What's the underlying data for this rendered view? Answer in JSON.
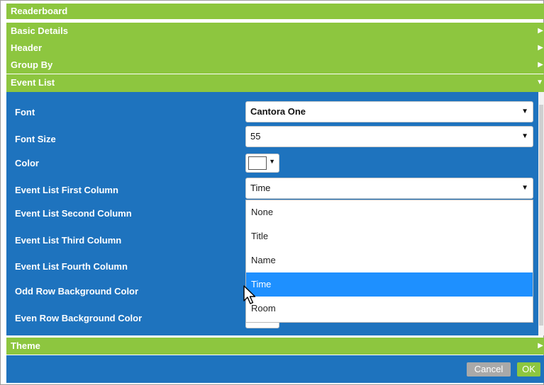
{
  "dialog": {
    "title": "Readerboard"
  },
  "sections": [
    {
      "label": "Basic Details",
      "arrow": "▶"
    },
    {
      "label": "Header",
      "arrow": "▶"
    },
    {
      "label": "Group By",
      "arrow": "▶"
    },
    {
      "label": "Event List",
      "arrow": "▼"
    },
    {
      "label": "Theme",
      "arrow": "▶"
    }
  ],
  "event_list": {
    "fields": {
      "font": {
        "label": "Font",
        "value": "Cantora One"
      },
      "font_size": {
        "label": "Font Size",
        "value": "55"
      },
      "color": {
        "label": "Color",
        "value": "#ffffff"
      },
      "first_column": {
        "label": "Event List First Column",
        "value": "Time"
      },
      "second_column": {
        "label": "Event List Second Column"
      },
      "third_column": {
        "label": "Event List Third Column"
      },
      "fourth_column": {
        "label": "Event List Fourth Column"
      },
      "odd_row_bg": {
        "label": "Odd Row Background Color"
      },
      "even_row_bg": {
        "label": "Even Row Background Color"
      }
    },
    "caret": "▼",
    "open_dropdown": {
      "options": [
        "None",
        "Title",
        "Name",
        "Time",
        "Room"
      ],
      "selected": "Time"
    }
  },
  "footer": {
    "cancel_label": "Cancel",
    "ok_label": "OK"
  },
  "colors": {
    "accent_green": "#8dc63f",
    "panel_blue": "#1e73be",
    "highlight_blue": "#1e90ff",
    "button_gray": "#a9a9a9"
  }
}
